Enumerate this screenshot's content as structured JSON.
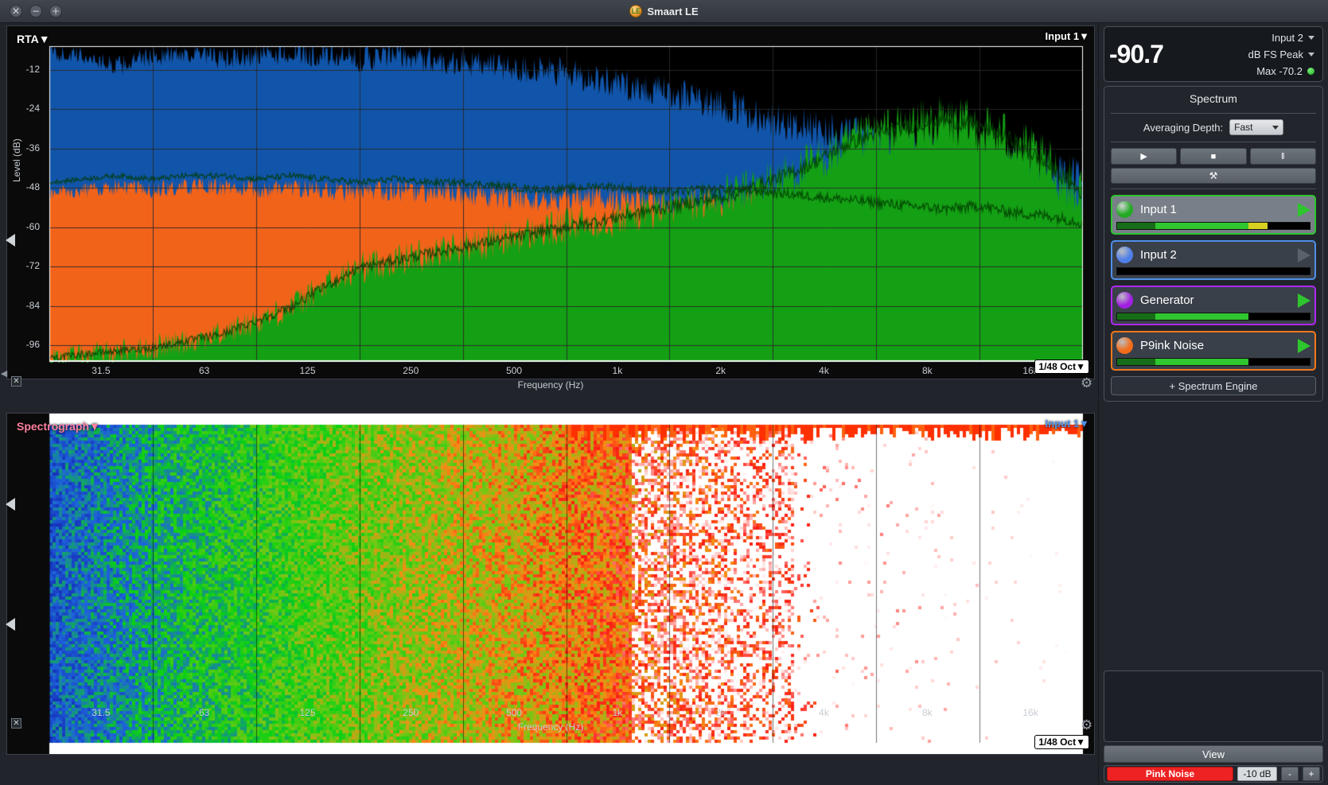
{
  "window": {
    "title": "Smaart LE",
    "close_icon": "close-icon",
    "minimize_icon": "minimize-icon",
    "maximize_icon": "maximize-icon"
  },
  "rta": {
    "title": "RTA",
    "title_caret": "▼",
    "source_label": "Input 1",
    "source_caret": "▼",
    "resolution": "1/48 Oct",
    "resolution_caret": "▼",
    "ylabel": "Level (dB)",
    "xlabel": "Frequency (Hz)",
    "yticks": [
      "-12",
      "-24",
      "-36",
      "-48",
      "-60",
      "-72",
      "-84",
      "-96"
    ],
    "xticks": [
      "31.5",
      "63",
      "125",
      "250",
      "500",
      "1k",
      "2k",
      "4k",
      "8k",
      "16k"
    ],
    "gear_icon": "gear-icon"
  },
  "spectrograph": {
    "title": "Spectrograph",
    "title_caret": "▼",
    "source_label": "Input 1",
    "source_caret": "▼",
    "resolution": "1/48 Oct",
    "resolution_caret": "▼",
    "xlabel": "Frequency (Hz)",
    "xticks": [
      "31.5",
      "63",
      "125",
      "250",
      "500",
      "1k",
      "2k",
      "4k",
      "8k",
      "16k"
    ],
    "gear_icon": "gear-icon",
    "close_icon": "close-box-icon"
  },
  "meter": {
    "value": "-90.7",
    "input_label": "Input 2",
    "units_label": "dB FS Peak",
    "max_label": "Max -70.2",
    "status_dot": "green-status-dot"
  },
  "spectrum": {
    "section_title": "Spectrum",
    "averaging_label": "Averaging Depth:",
    "averaging_value": "Fast",
    "transport": [
      {
        "name": "play-button",
        "glyph": "▶"
      },
      {
        "name": "stop-button",
        "glyph": "■"
      },
      {
        "name": "pause-button",
        "glyph": "‖"
      }
    ],
    "tools_glyph": "⚒",
    "add_engine_label": "+ Spectrum Engine",
    "channels": [
      {
        "name": "Input 1",
        "dot_color": "#22aa22",
        "border_color": "#2ec62e",
        "active": true,
        "play": true,
        "level": 78
      },
      {
        "name": "Input 2",
        "dot_color": "#4f7fe8",
        "border_color": "#4f8fe8",
        "active": false,
        "play": false,
        "level": 0
      },
      {
        "name": "Generator",
        "dot_color": "#a020e0",
        "border_color": "#b028f0",
        "active": false,
        "play": true,
        "level": 68
      },
      {
        "name": "P9ink Noise",
        "dot_color": "#f26c1a",
        "border_color": "#f2781a",
        "active": false,
        "play": true,
        "level": 68
      }
    ]
  },
  "bottom": {
    "view_label": "View",
    "pink_noise_label": "Pink Noise",
    "level_value": "-10 dB",
    "minus_label": "-",
    "plus_label": "+"
  },
  "colors": {
    "rta_blue": "#1155aa",
    "rta_orange": "#f2631a",
    "rta_green": "#14a014",
    "accent_red": "#ee2222"
  },
  "chart_data": {
    "type": "area",
    "title": "RTA",
    "xlabel": "Frequency (Hz)",
    "ylabel": "Level (dB)",
    "ylim": [
      -100,
      -6
    ],
    "xlim_hz": [
      20,
      20000
    ],
    "xticks": [
      "31.5",
      "63",
      "125",
      "250",
      "500",
      "1k",
      "2k",
      "4k",
      "8k",
      "16k"
    ],
    "yticks": [
      -12,
      -24,
      -36,
      -48,
      -60,
      -72,
      -84,
      -96
    ],
    "grid": true,
    "legend": "Input 1",
    "series": [
      {
        "name": "Input 1 (blue trace)",
        "color": "#1155aa",
        "freqs_hz": [
          20,
          25,
          31.5,
          40,
          50,
          63,
          80,
          100,
          125,
          160,
          200,
          250,
          315,
          400,
          500,
          630,
          800,
          1000,
          1250,
          1600,
          2000,
          2500,
          3150,
          4000,
          5000,
          6300,
          8000,
          10000,
          12500,
          16000,
          20000
        ],
        "values_db": [
          -8,
          -9,
          -12,
          -9,
          -8,
          -10,
          -9,
          -8,
          -9,
          -10,
          -9,
          -10,
          -11,
          -12,
          -13,
          -14,
          -16,
          -18,
          -20,
          -22,
          -25,
          -28,
          -30,
          -32,
          -34,
          -36,
          -38,
          -40,
          -42,
          -44,
          -46
        ]
      },
      {
        "name": "Pink Noise (orange trace)",
        "color": "#f2631a",
        "freqs_hz": [
          20,
          25,
          31.5,
          40,
          50,
          63,
          80,
          100,
          125,
          160,
          200,
          250,
          315,
          400,
          500,
          630,
          800,
          1000,
          1250,
          1600,
          2000,
          2500,
          3150,
          4000,
          5000,
          6300,
          8000,
          10000,
          12500,
          16000,
          20000
        ],
        "values_db": [
          -50,
          -49,
          -48,
          -49,
          -48,
          -48,
          -49,
          -48,
          -49,
          -50,
          -49,
          -50,
          -50,
          -51,
          -52,
          -52,
          -51,
          -52,
          -53,
          -52,
          -52,
          -53,
          -54,
          -55,
          -56,
          -57,
          -58,
          -57,
          -59,
          -60,
          -62
        ]
      },
      {
        "name": "Generator (green fill)",
        "color": "#14a014",
        "freqs_hz": [
          20,
          25,
          31.5,
          40,
          50,
          63,
          80,
          100,
          125,
          160,
          200,
          250,
          315,
          400,
          500,
          630,
          800,
          1000,
          1250,
          1600,
          2000,
          2500,
          3150,
          4000,
          5000,
          6300,
          8000,
          10000,
          12500,
          16000,
          20000
        ],
        "values_db": [
          -99,
          -98,
          -97,
          -96,
          -94,
          -92,
          -88,
          -84,
          -78,
          -72,
          -70,
          -68,
          -66,
          -64,
          -62,
          -60,
          -58,
          -56,
          -54,
          -52,
          -50,
          -46,
          -42,
          -36,
          -32,
          -30,
          -28,
          -30,
          -34,
          -42,
          -50
        ]
      }
    ]
  }
}
